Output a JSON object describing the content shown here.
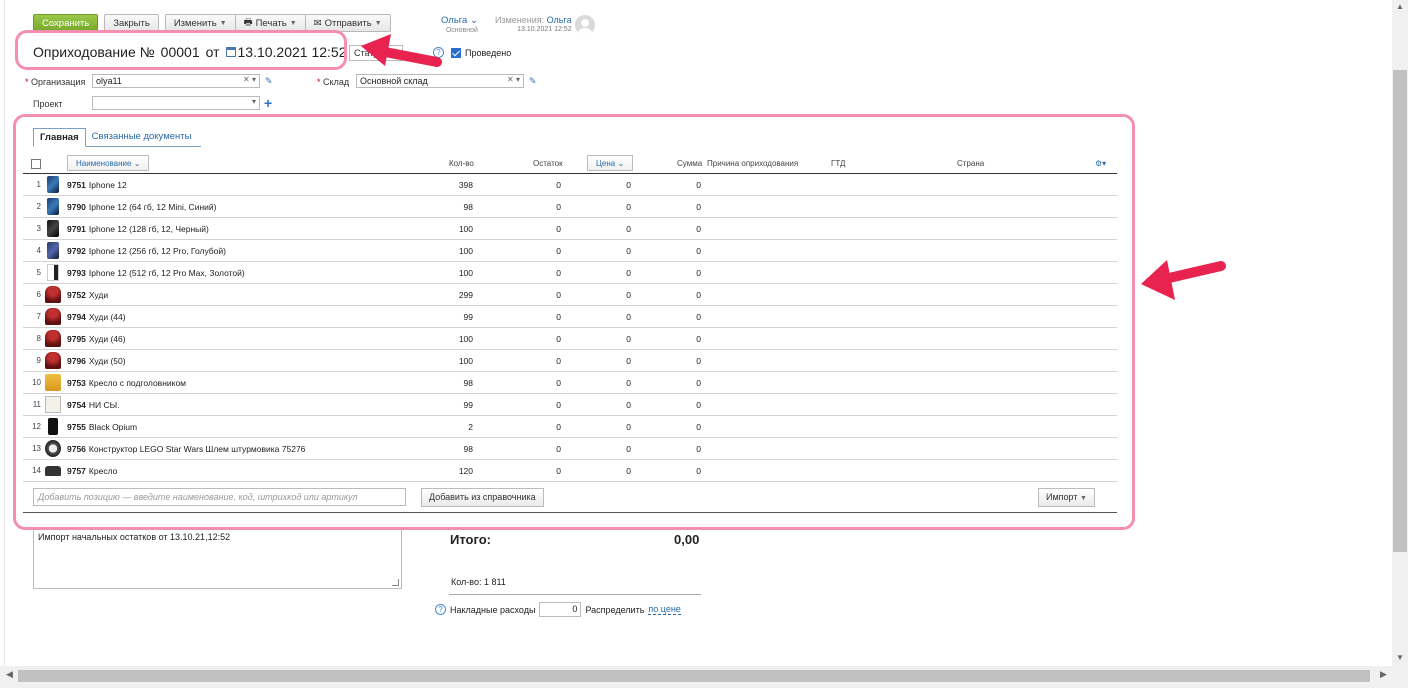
{
  "toolbar": {
    "save": "Сохранить",
    "close": "Закрыть",
    "edit": "Изменить",
    "print": "Печать",
    "send": "Отправить"
  },
  "user": {
    "name": "Ольга",
    "role": "Основной",
    "changes_label": "Изменения:",
    "changes_user": "Ольга",
    "changes_time": "13.10.2021 12:52"
  },
  "doc": {
    "title": "Оприходование №",
    "number": "00001",
    "from": "от",
    "date": "13.10.2021 12:52",
    "status": "Статус",
    "posted_label": "Проведено"
  },
  "form": {
    "org_label": "Организация",
    "org_value": "olya11",
    "warehouse_label": "Склад",
    "warehouse_value": "Основной склад",
    "project_label": "Проект",
    "project_value": ""
  },
  "tabs": [
    {
      "label": "Главная"
    },
    {
      "label": "Связанные документы"
    }
  ],
  "table": {
    "headers": {
      "name": "Наименование",
      "qty": "Кол-во",
      "stock": "Остаток",
      "price": "Цена",
      "sum": "Сумма",
      "reason": "Причина оприходования",
      "gtd": "ГТД",
      "country": "Страна"
    },
    "rows": [
      {
        "n": "1",
        "code": "9751",
        "name": "Iphone 12",
        "qty": "398",
        "stock": "0",
        "price": "0",
        "sum": "0",
        "img": "phone"
      },
      {
        "n": "2",
        "code": "9790",
        "name": "Iphone 12 (64 гб, 12 Mini, Синий)",
        "qty": "98",
        "stock": "0",
        "price": "0",
        "sum": "0",
        "img": "phone"
      },
      {
        "n": "3",
        "code": "9791",
        "name": "Iphone 12 (128 гб, 12, Черный)",
        "qty": "100",
        "stock": "0",
        "price": "0",
        "sum": "0",
        "img": "phone-dark"
      },
      {
        "n": "4",
        "code": "9792",
        "name": "Iphone 12 (256 гб, 12 Pro, Голубой)",
        "qty": "100",
        "stock": "0",
        "price": "0",
        "sum": "0",
        "img": "phone-blue"
      },
      {
        "n": "5",
        "code": "9793",
        "name": "Iphone 12 (512 гб, 12 Pro Max, Золотой)",
        "qty": "100",
        "stock": "0",
        "price": "0",
        "sum": "0",
        "img": "phone-gold"
      },
      {
        "n": "6",
        "code": "9752",
        "name": "Худи",
        "qty": "299",
        "stock": "0",
        "price": "0",
        "sum": "0",
        "img": "hoodie"
      },
      {
        "n": "7",
        "code": "9794",
        "name": "Худи (44)",
        "qty": "99",
        "stock": "0",
        "price": "0",
        "sum": "0",
        "img": "hoodie"
      },
      {
        "n": "8",
        "code": "9795",
        "name": "Худи (46)",
        "qty": "100",
        "stock": "0",
        "price": "0",
        "sum": "0",
        "img": "hoodie"
      },
      {
        "n": "9",
        "code": "9796",
        "name": "Худи (50)",
        "qty": "100",
        "stock": "0",
        "price": "0",
        "sum": "0",
        "img": "hoodie"
      },
      {
        "n": "10",
        "code": "9753",
        "name": "Кресло с подголовником",
        "qty": "98",
        "stock": "0",
        "price": "0",
        "sum": "0",
        "img": "chair"
      },
      {
        "n": "11",
        "code": "9754",
        "name": "НИ СЫ.",
        "qty": "99",
        "stock": "0",
        "price": "0",
        "sum": "0",
        "img": "box"
      },
      {
        "n": "12",
        "code": "9755",
        "name": "Black Opium",
        "qty": "2",
        "stock": "0",
        "price": "0",
        "sum": "0",
        "img": "bottle"
      },
      {
        "n": "13",
        "code": "9756",
        "name": "Конструктор LEGO Star Wars Шлем штурмовика 75276",
        "qty": "98",
        "stock": "0",
        "price": "0",
        "sum": "0",
        "img": "lego"
      },
      {
        "n": "14",
        "code": "9757",
        "name": "Кресло",
        "qty": "120",
        "stock": "0",
        "price": "0",
        "sum": "0",
        "img": "chair2"
      }
    ]
  },
  "add_position_placeholder": "Добавить позицию — введите наименование, код, штрихкод или артикул",
  "add_from_catalog": "Добавить из справочника",
  "import_label": "Импорт",
  "comment": "Импорт начальных остатков от 13.10.21,12:52",
  "totals": {
    "label": "Итого:",
    "value": "0,00",
    "qty": "Кол-во: 1 811",
    "overhead_label": "Накладные расходы",
    "overhead_value": "0",
    "distribute_label": "Распределить",
    "distribute_link": "по цене"
  },
  "colors": {
    "highlight": "#f48fb1",
    "arrow": "#e8234f",
    "save": "#8bbd3c",
    "link": "#2a6aa8"
  }
}
